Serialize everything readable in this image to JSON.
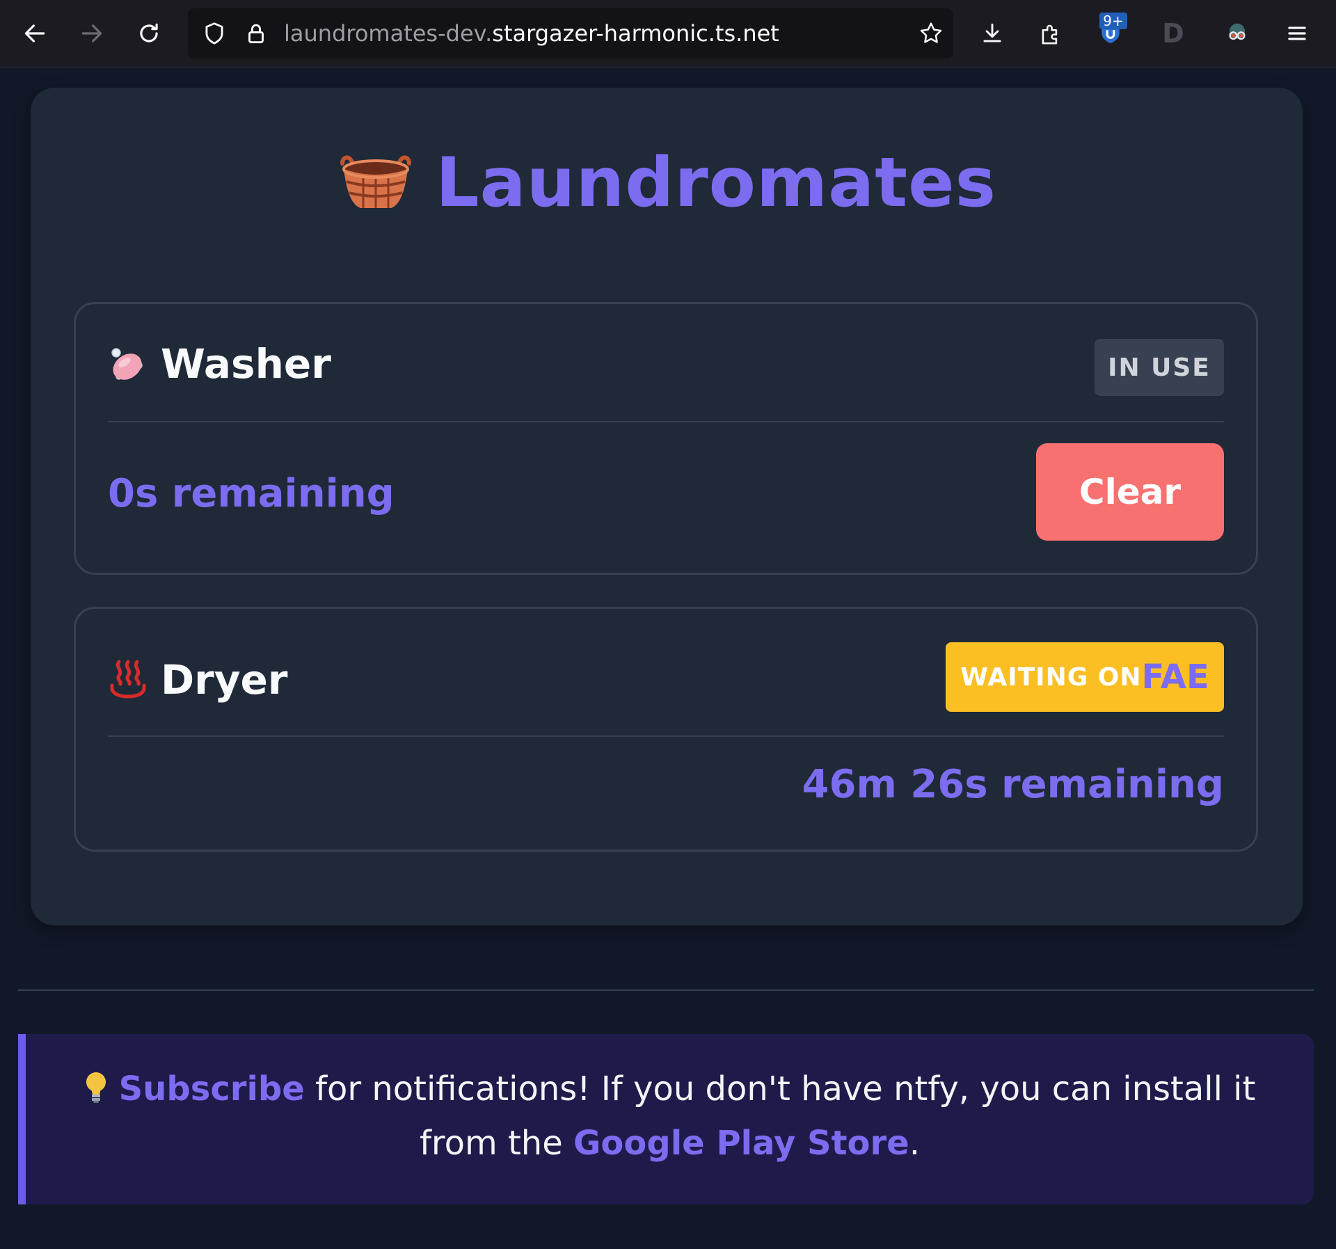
{
  "browser": {
    "url_subdomain": "laundromates-dev.",
    "url_domain": "stargazer-harmonic.ts.net",
    "extension_badge": "9+",
    "extension_letter": "D"
  },
  "app": {
    "title": "Laundromates",
    "title_icon": "laundry-basket-icon"
  },
  "machines": [
    {
      "name": "Washer",
      "icon": "soap-icon",
      "status": "IN USE",
      "remaining": "0s remaining",
      "action_label": "Clear"
    },
    {
      "name": "Dryer",
      "icon": "hot-springs-icon",
      "status_label": "WAITING ON",
      "status_user": "FAE",
      "remaining": "46m 26s remaining"
    }
  ],
  "notice": {
    "icon": "lightbulb-icon",
    "subscribe_link": "Subscribe",
    "text_1": " for notifications! If you don't have ntfy, you can install it from the ",
    "store_link": "Google Play Store",
    "text_2": "."
  },
  "colors": {
    "accent": "#7b6cf0",
    "clear_button": "#f87171",
    "waiting_badge": "#fbbf24",
    "inuse_badge": "#374151",
    "background": "#111827",
    "card": "#1f2937"
  }
}
